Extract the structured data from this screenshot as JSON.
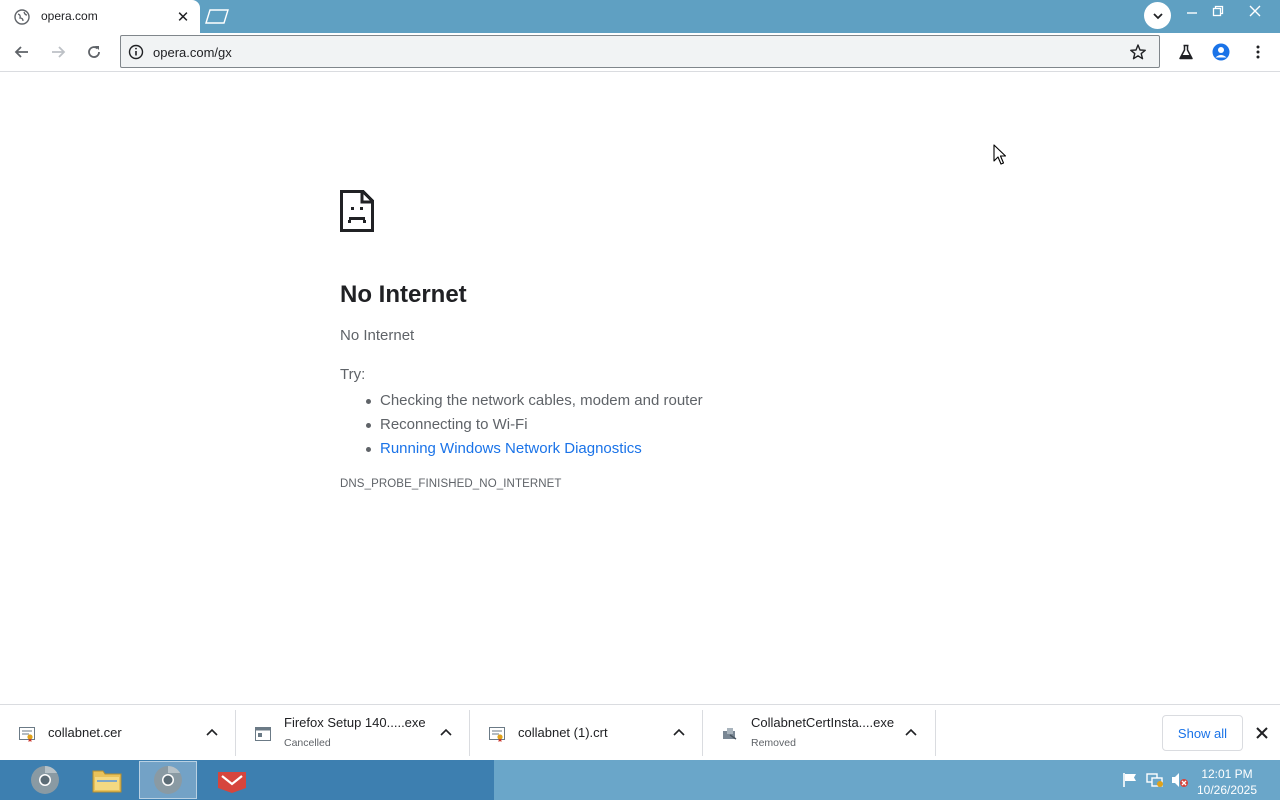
{
  "browser": {
    "tab": {
      "title": "opera.com"
    },
    "address_bar": {
      "url": "opera.com/gx"
    }
  },
  "error_page": {
    "heading": "No Internet",
    "subtitle": "No Internet",
    "try_label": "Try:",
    "suggestions": [
      "Checking the network cables, modem and router",
      "Reconnecting to Wi-Fi",
      "Running Windows Network Diagnostics"
    ],
    "error_code": "DNS_PROBE_FINISHED_NO_INTERNET"
  },
  "downloads": {
    "items": [
      {
        "name": "collabnet.cer",
        "status": ""
      },
      {
        "name": "Firefox Setup 140.....exe",
        "status": "Cancelled"
      },
      {
        "name": "collabnet (1).crt",
        "status": ""
      },
      {
        "name": "CollabnetCertInsta....exe",
        "status": "Removed"
      }
    ],
    "show_all_label": "Show all"
  },
  "taskbar": {
    "time": "12:01 PM",
    "date": "10/26/2025"
  },
  "colors": {
    "tabstrip": "#5fa0c2",
    "link": "#1a73e8",
    "taskbar": "#3d7fb0"
  }
}
